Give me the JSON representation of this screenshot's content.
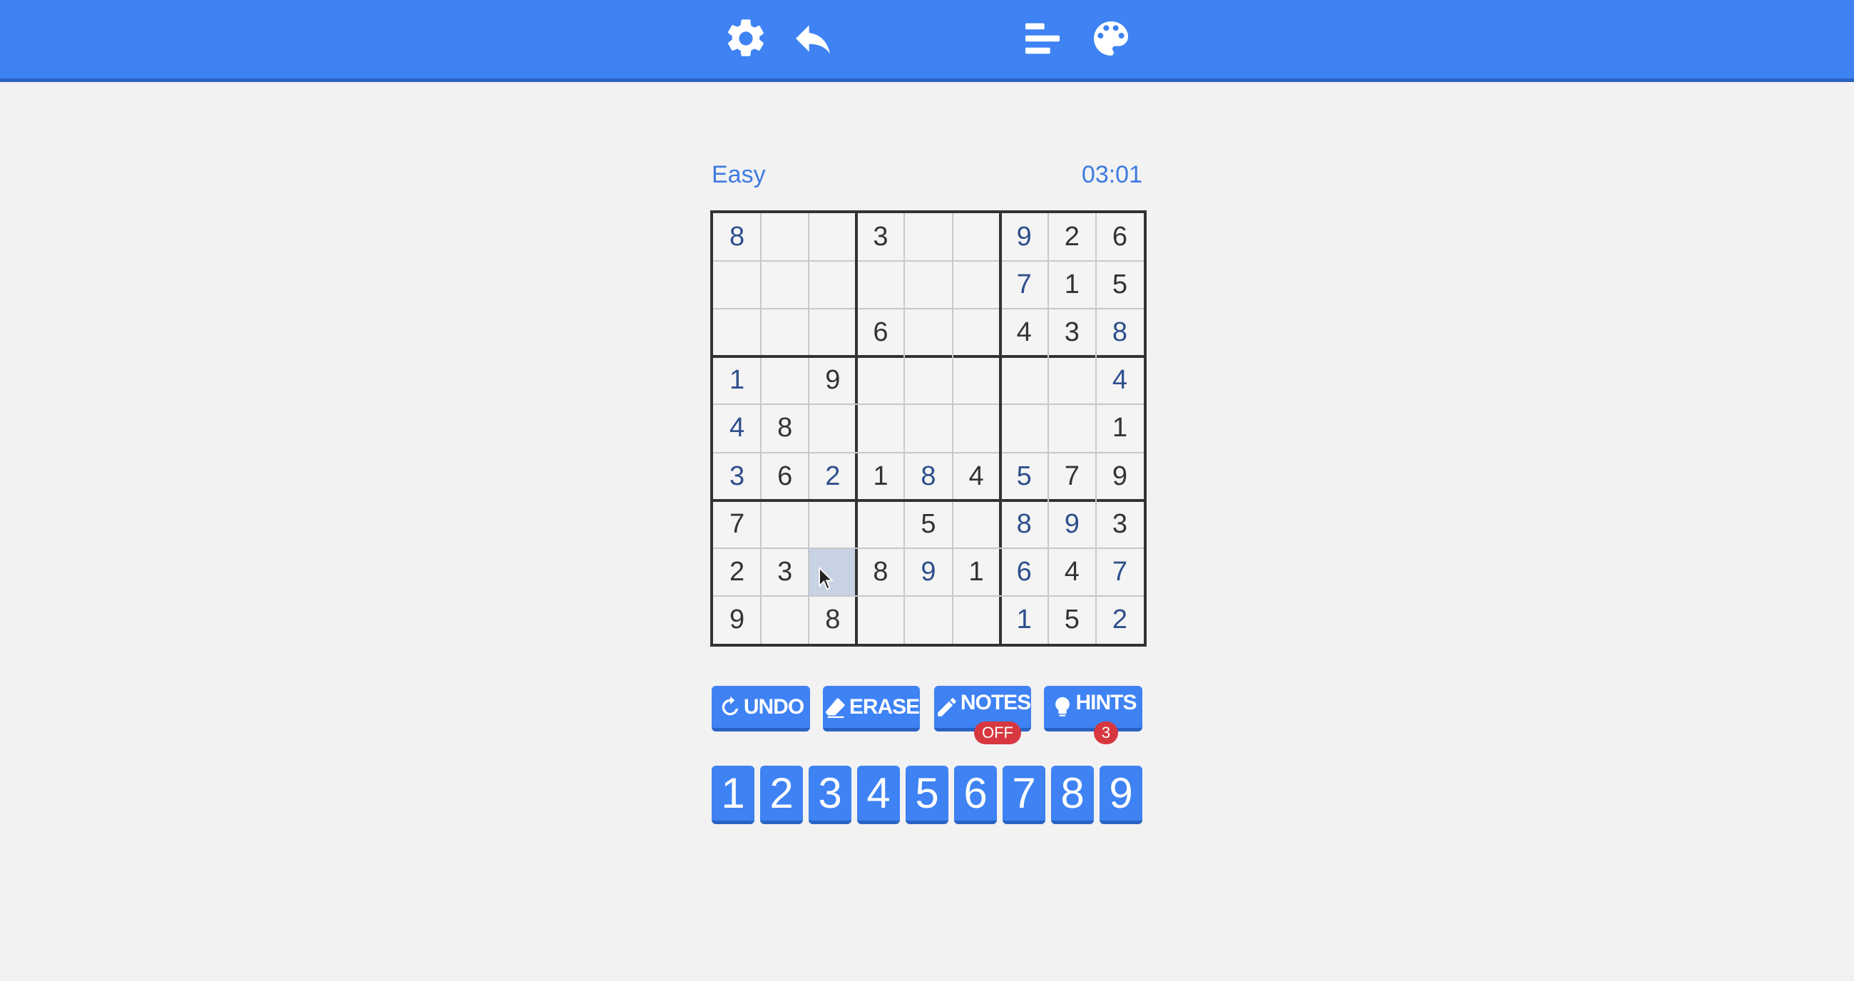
{
  "toolbar": {
    "icons": [
      "gear-icon",
      "undo-arrow-icon",
      "leaderboard-icon",
      "palette-icon"
    ]
  },
  "game": {
    "difficulty": "Easy",
    "timer": "03:01"
  },
  "board": {
    "rows": [
      [
        {
          "v": "8",
          "u": true
        },
        {
          "v": "",
          "u": false
        },
        {
          "v": "",
          "u": false
        },
        {
          "v": "3",
          "u": false
        },
        {
          "v": "",
          "u": false
        },
        {
          "v": "",
          "u": false
        },
        {
          "v": "9",
          "u": true
        },
        {
          "v": "2",
          "u": false
        },
        {
          "v": "6",
          "u": false
        }
      ],
      [
        {
          "v": "",
          "u": false
        },
        {
          "v": "",
          "u": false
        },
        {
          "v": "",
          "u": false
        },
        {
          "v": "",
          "u": false
        },
        {
          "v": "",
          "u": false
        },
        {
          "v": "",
          "u": false
        },
        {
          "v": "7",
          "u": true
        },
        {
          "v": "1",
          "u": false
        },
        {
          "v": "5",
          "u": false
        }
      ],
      [
        {
          "v": "",
          "u": false
        },
        {
          "v": "",
          "u": false
        },
        {
          "v": "",
          "u": false
        },
        {
          "v": "6",
          "u": false
        },
        {
          "v": "",
          "u": false
        },
        {
          "v": "",
          "u": false
        },
        {
          "v": "4",
          "u": false
        },
        {
          "v": "3",
          "u": false
        },
        {
          "v": "8",
          "u": true
        }
      ],
      [
        {
          "v": "1",
          "u": true
        },
        {
          "v": "",
          "u": false
        },
        {
          "v": "9",
          "u": false
        },
        {
          "v": "",
          "u": false
        },
        {
          "v": "",
          "u": false
        },
        {
          "v": "",
          "u": false
        },
        {
          "v": "",
          "u": false
        },
        {
          "v": "",
          "u": false
        },
        {
          "v": "4",
          "u": true
        }
      ],
      [
        {
          "v": "4",
          "u": true
        },
        {
          "v": "8",
          "u": false
        },
        {
          "v": "",
          "u": false
        },
        {
          "v": "",
          "u": false
        },
        {
          "v": "",
          "u": false
        },
        {
          "v": "",
          "u": false
        },
        {
          "v": "",
          "u": false
        },
        {
          "v": "",
          "u": false
        },
        {
          "v": "1",
          "u": false
        }
      ],
      [
        {
          "v": "3",
          "u": true
        },
        {
          "v": "6",
          "u": false
        },
        {
          "v": "2",
          "u": true
        },
        {
          "v": "1",
          "u": false
        },
        {
          "v": "8",
          "u": true
        },
        {
          "v": "4",
          "u": false
        },
        {
          "v": "5",
          "u": true
        },
        {
          "v": "7",
          "u": false
        },
        {
          "v": "9",
          "u": false
        }
      ],
      [
        {
          "v": "7",
          "u": false
        },
        {
          "v": "",
          "u": false
        },
        {
          "v": "",
          "u": false
        },
        {
          "v": "",
          "u": false
        },
        {
          "v": "5",
          "u": false
        },
        {
          "v": "",
          "u": false
        },
        {
          "v": "8",
          "u": true
        },
        {
          "v": "9",
          "u": true
        },
        {
          "v": "3",
          "u": false
        }
      ],
      [
        {
          "v": "2",
          "u": false
        },
        {
          "v": "3",
          "u": false
        },
        {
          "v": "",
          "u": false
        },
        {
          "v": "8",
          "u": false
        },
        {
          "v": "9",
          "u": true
        },
        {
          "v": "1",
          "u": false
        },
        {
          "v": "6",
          "u": true
        },
        {
          "v": "4",
          "u": false
        },
        {
          "v": "7",
          "u": true
        }
      ],
      [
        {
          "v": "9",
          "u": false
        },
        {
          "v": "",
          "u": false
        },
        {
          "v": "8",
          "u": false
        },
        {
          "v": "",
          "u": false
        },
        {
          "v": "",
          "u": false
        },
        {
          "v": "",
          "u": false
        },
        {
          "v": "1",
          "u": true
        },
        {
          "v": "5",
          "u": false
        },
        {
          "v": "2",
          "u": true
        }
      ]
    ],
    "selected": {
      "row": 7,
      "col": 2
    }
  },
  "actions": {
    "undo_label": "UNDO",
    "erase_label": "ERASE",
    "notes_label": "NOTES",
    "notes_state": "OFF",
    "hints_label": "HINTS",
    "hints_count": "3"
  },
  "numpad": [
    "1",
    "2",
    "3",
    "4",
    "5",
    "6",
    "7",
    "8",
    "9"
  ],
  "colors": {
    "accent": "#3e82f3",
    "badge": "#d7383f",
    "user_digit": "#2e4f8c",
    "given_digit": "#333333",
    "selected_cell": "#c7d2e3"
  }
}
